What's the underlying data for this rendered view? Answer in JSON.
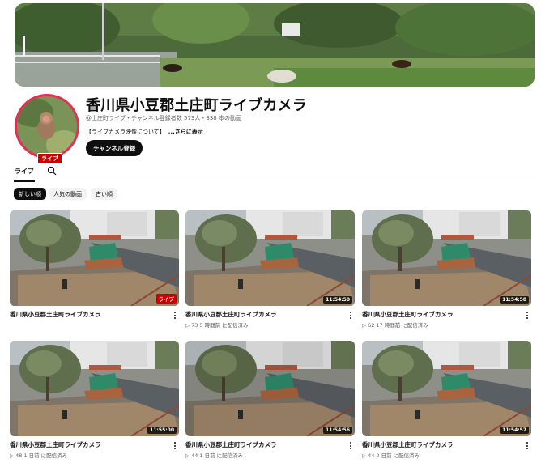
{
  "channel": {
    "title": "香川県小豆郡土庄町ライブカメラ",
    "meta": "@土庄町ライブ・チャンネル登録者数 573人・338 本の動画",
    "description": "【ライブカメラ映像について】",
    "more": "...さらに表示",
    "subscribe_label": "チャンネル登録",
    "avatar_badge": "ライブ"
  },
  "tabs": {
    "live_label": "ライブ",
    "search_icon": "search-icon"
  },
  "chips": [
    "新しい順",
    "人気の動画",
    "古い順"
  ],
  "videos": [
    {
      "title": "香川県小豆郡土庄町ライブカメラ",
      "meta": "",
      "badge": "ライブ",
      "duration": ""
    },
    {
      "title": "香川県小豆郡土庄町ライブカメラ",
      "meta": "▷ 73  5 時間前 に配信済み",
      "badge": "",
      "duration": "11:54:50"
    },
    {
      "title": "香川県小豆郡土庄町ライブカメラ",
      "meta": "▷ 62  17 時間前 に配信済み",
      "badge": "",
      "duration": "11:54:58"
    },
    {
      "title": "香川県小豆郡土庄町ライブカメラ",
      "meta": "▷ 48  1 日前 に配信済み",
      "badge": "",
      "duration": "11:55:00"
    },
    {
      "title": "香川県小豆郡土庄町ライブカメラ",
      "meta": "▷ 44  1 日前 に配信済み",
      "badge": "",
      "duration": "11:54:56"
    },
    {
      "title": "香川県小豆郡土庄町ライブカメラ",
      "meta": "▷ 44  2 日前 に配信済み",
      "badge": "",
      "duration": "11:54:57"
    }
  ]
}
